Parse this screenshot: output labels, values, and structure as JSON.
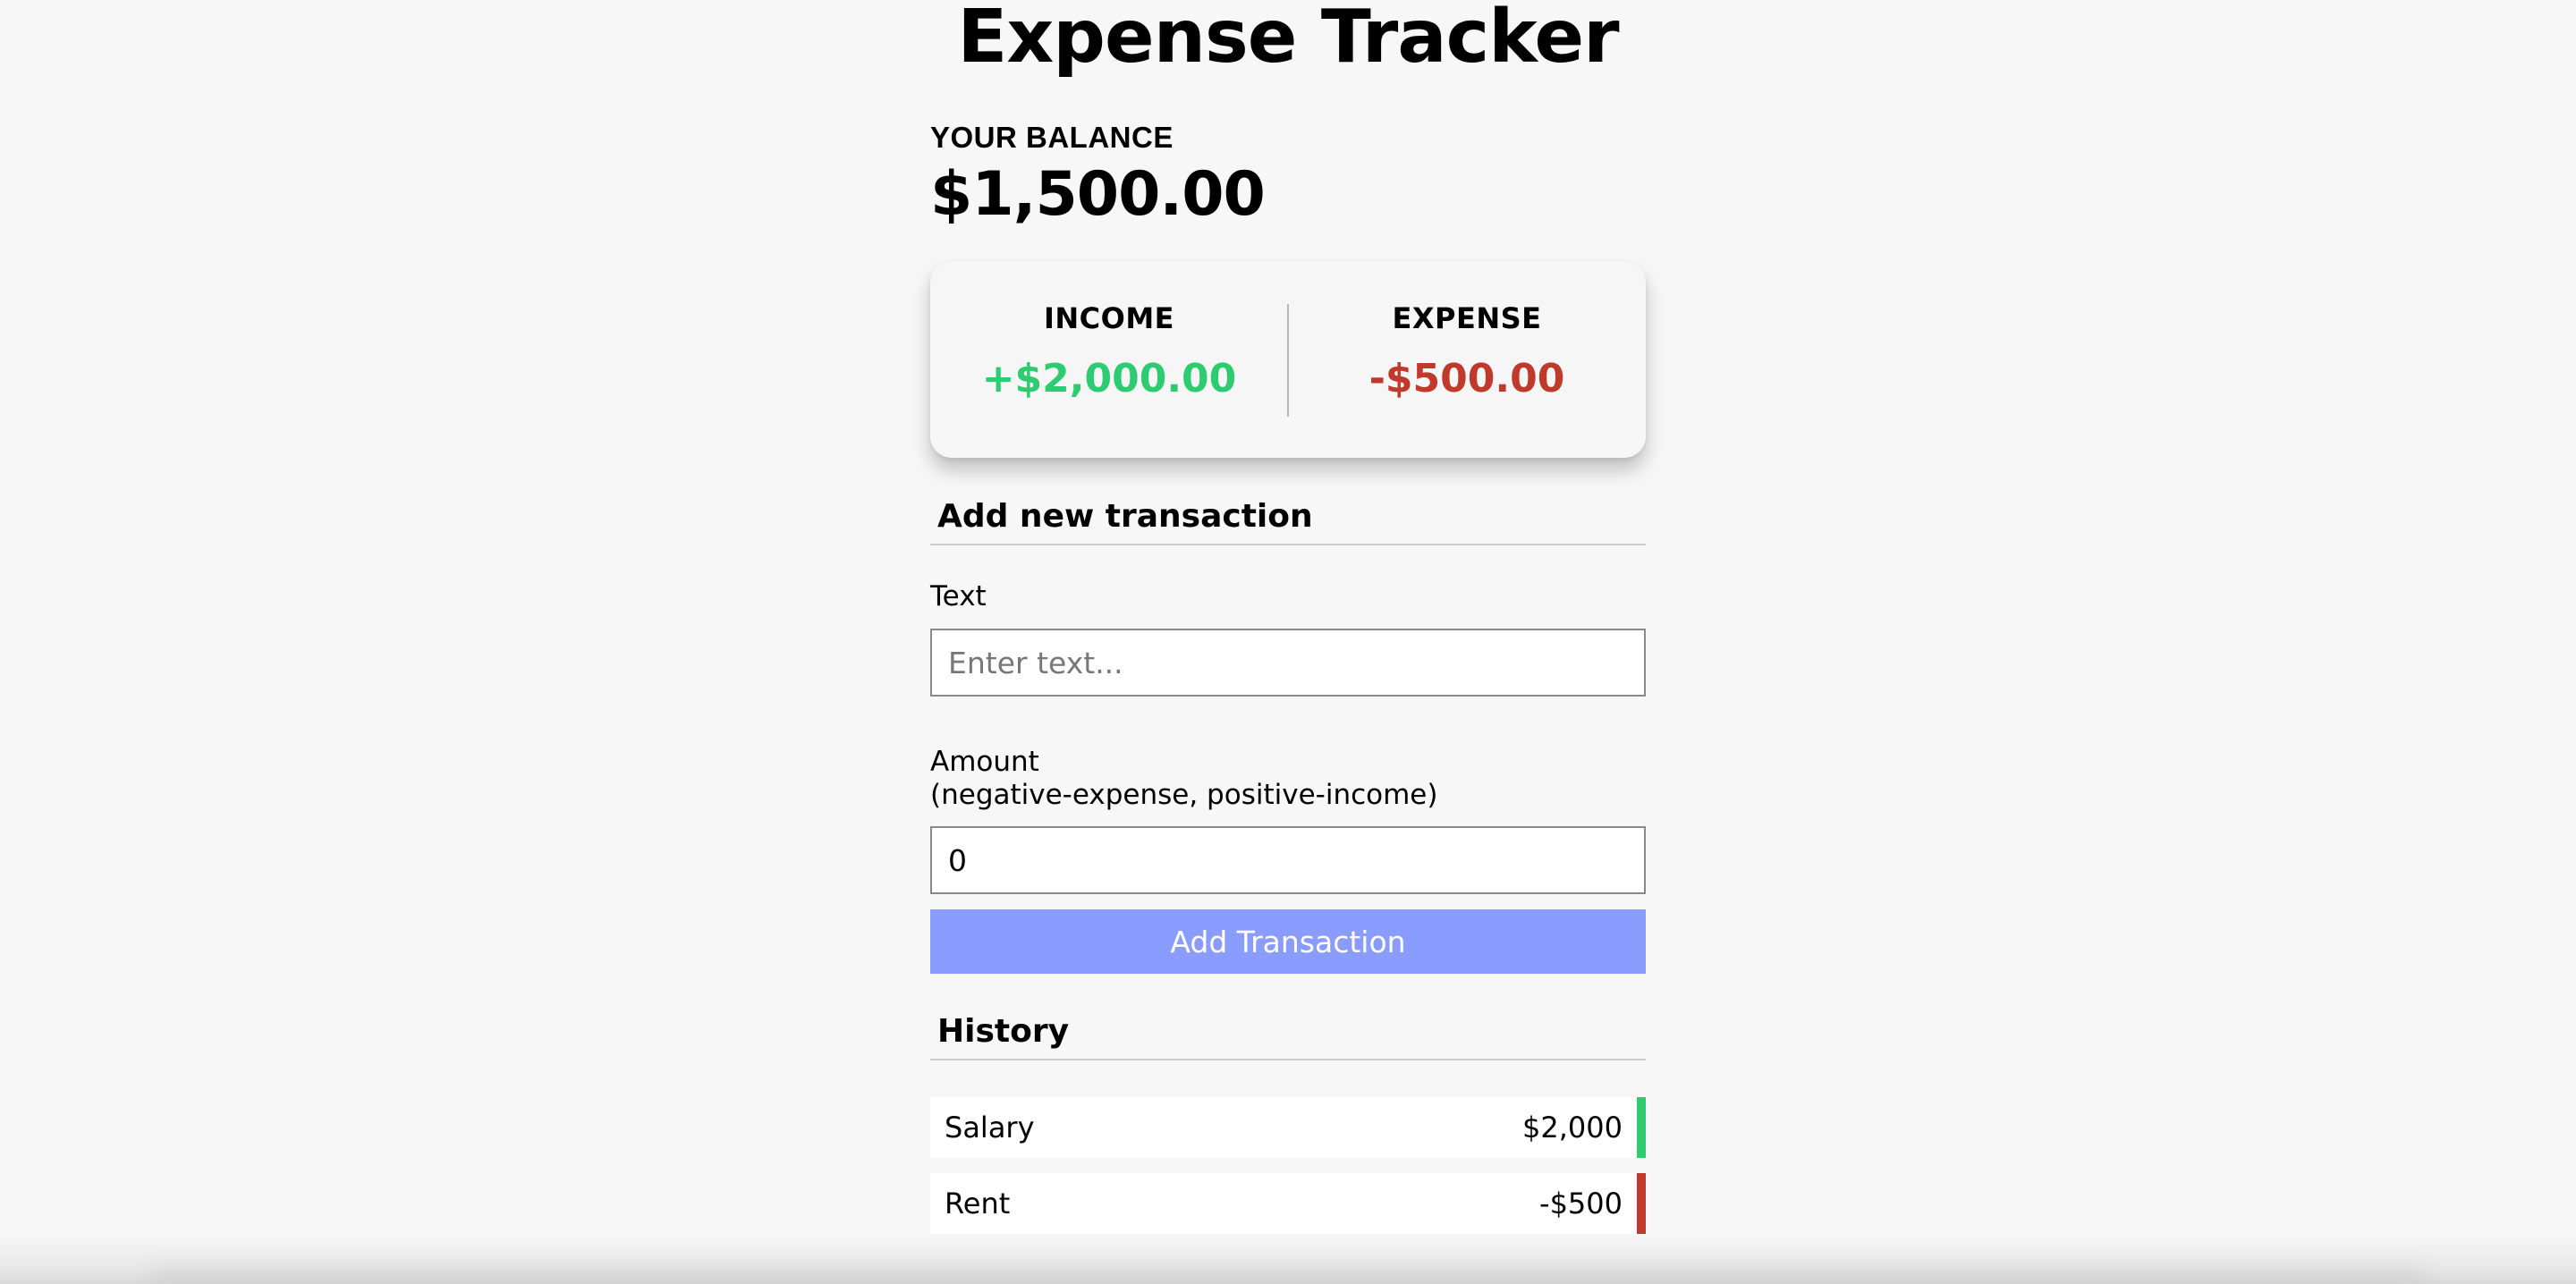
{
  "app": {
    "title": "Expense Tracker"
  },
  "balance": {
    "label": "YOUR BALANCE",
    "value": "$1,500.00"
  },
  "summary": {
    "income_label": "INCOME",
    "income_value": "+$2,000.00",
    "expense_label": "EXPENSE",
    "expense_value": "-$500.00",
    "income_color": "#2ecc71",
    "expense_color": "#c0392b"
  },
  "form": {
    "heading": "Add new transaction",
    "text_label": "Text",
    "text_placeholder": "Enter text...",
    "text_value": "",
    "amount_label": "Amount",
    "amount_hint": "(negative-expense, positive-income)",
    "amount_value": "0",
    "submit_label": "Add Transaction",
    "submit_color": "#8a9cfd"
  },
  "history": {
    "heading": "History",
    "items": [
      {
        "text": "Salary",
        "amount": "$2,000",
        "type": "income"
      },
      {
        "text": "Rent",
        "amount": "-$500",
        "type": "expense"
      }
    ]
  }
}
